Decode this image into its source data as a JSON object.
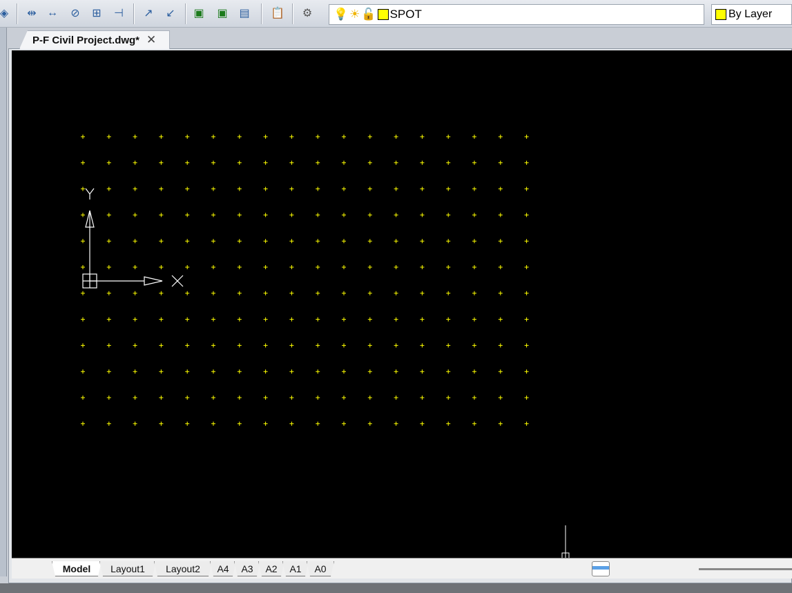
{
  "toolbar": {
    "icons": [
      "layer-states-icon",
      "dimension-select-icon",
      "linear-dimension-icon",
      "diameter-dimension-icon",
      "baseline-dimension-icon",
      "center-mark-icon",
      "add-annotation-icon",
      "remove-annotation-icon",
      "export-excel-icon",
      "import-excel-icon",
      "quick-properties-icon",
      "checklist-icon",
      "zoom-settings-icon"
    ]
  },
  "layer": {
    "name": "SPOT",
    "color": "#ffff00"
  },
  "color_control": {
    "value": "By Layer",
    "color": "#ffff00"
  },
  "document_tab": {
    "title": "P-F Civil Project.dwg*",
    "close": "✕"
  },
  "canvas": {
    "background": "#000000",
    "point_color": "#ffff00",
    "grid": {
      "cols": 18,
      "rows": 12
    },
    "ucs": {
      "x_label": "X",
      "y_label": "Y"
    }
  },
  "layout_tabs": [
    "Model",
    "Layout1",
    "Layout2",
    "A4",
    "A3",
    "A2",
    "A1",
    "A0"
  ],
  "active_layout": "Model"
}
